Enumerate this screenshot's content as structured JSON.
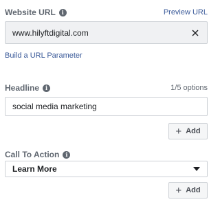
{
  "website_url": {
    "label": "Website URL",
    "preview_link": "Preview URL",
    "value": "www.hilyftdigital.com",
    "build_param_link": "Build a URL Parameter"
  },
  "headline": {
    "label": "Headline",
    "options_count": "1/5 options",
    "value": "social media marketing",
    "add_label": "Add"
  },
  "call_to_action": {
    "label": "Call To Action",
    "selected": "Learn More",
    "add_label": "Add"
  },
  "icons": {
    "info": "i",
    "plus": "+"
  },
  "colors": {
    "link": "#385898",
    "label": "#606770",
    "border": "#ccd0d5",
    "field_grey": "#f0f1f3"
  }
}
